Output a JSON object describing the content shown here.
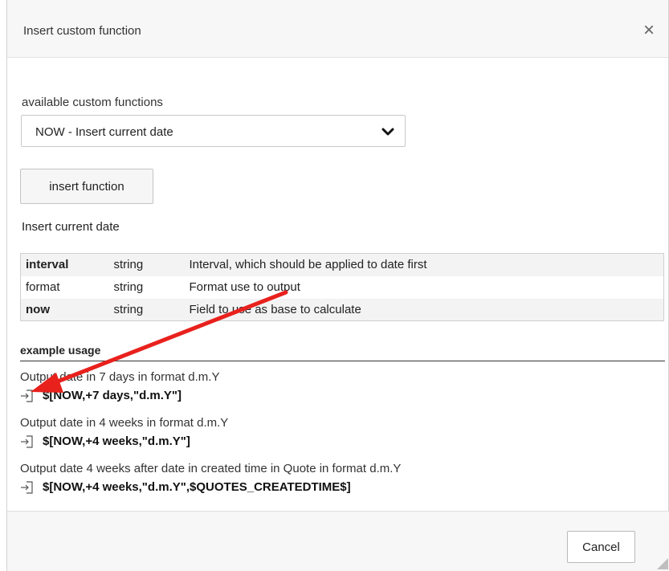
{
  "dialog": {
    "title": "Insert custom function",
    "close_glyph": "×"
  },
  "form": {
    "label": "available custom functions",
    "selected_function": "NOW - Insert current date",
    "insert_button": "insert function",
    "description": "Insert current date"
  },
  "parameters": [
    {
      "name": "interval",
      "type": "string",
      "description": "Interval, which should be applied to date first"
    },
    {
      "name": "format",
      "type": "string",
      "description": "Format use to output"
    },
    {
      "name": "now",
      "type": "string",
      "description": "Field to use as base to calculate"
    }
  ],
  "examples": {
    "heading": "example usage",
    "items": [
      {
        "text": "Output date in 7 days in format d.m.Y",
        "code": "$[NOW,+7 days,\"d.m.Y\"]"
      },
      {
        "text": "Output date in 4 weeks in format d.m.Y",
        "code": "$[NOW,+4 weeks,\"d.m.Y\"]"
      },
      {
        "text": "Output date 4 weeks after date in created time in Quote in format d.m.Y",
        "code": "$[NOW,+4 weeks,\"d.m.Y\",$QUOTES_CREATEDTIME$]"
      }
    ]
  },
  "footer": {
    "cancel_button": "Cancel"
  },
  "colors": {
    "annotation_arrow": "#e8211d"
  },
  "icons": {
    "close": "close-icon",
    "dropdown": "chevron-down-icon",
    "insert": "insert-into-icon",
    "resize": "resize-grip-icon"
  }
}
